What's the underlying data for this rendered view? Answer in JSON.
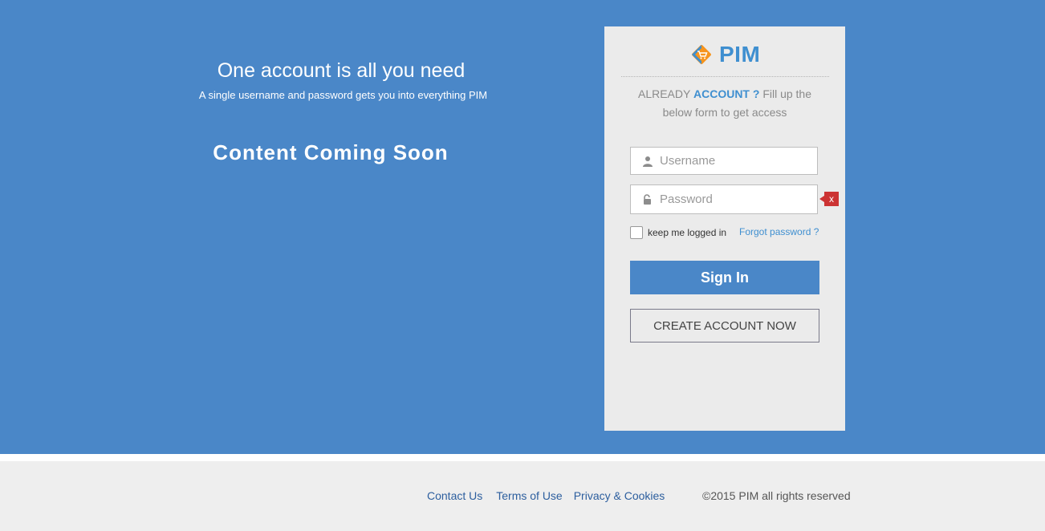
{
  "hero": {
    "headline": "One account is all you need",
    "subline": "A single username and password gets you into everything PIM",
    "coming_soon": "Content Coming Soon",
    "background": "#4a87c8"
  },
  "login": {
    "logo_text": "PIM",
    "logo_icon": "shopping-cart-diamond-logo",
    "intro_prefix": "ALREADY",
    "intro_emphasis": "ACCOUNT ?",
    "intro_suffix": "Fill up the below form to get access",
    "username_placeholder": "Username",
    "username_icon": "user-icon",
    "password_placeholder": "Password",
    "password_icon": "lock-icon",
    "password_error_marker": "x",
    "remember_label": "keep me logged in",
    "forgot_label": "Forgot password ?",
    "signin_label": "Sign In",
    "create_label": "CREATE ACCOUNT NOW",
    "accent": "#3f8fd0",
    "error_color": "#cc3333"
  },
  "footer": {
    "links": [
      "Contact Us",
      "Terms of Use",
      "Privacy & Cookies"
    ],
    "copyright": "©2015 PIM all rights reserved"
  }
}
